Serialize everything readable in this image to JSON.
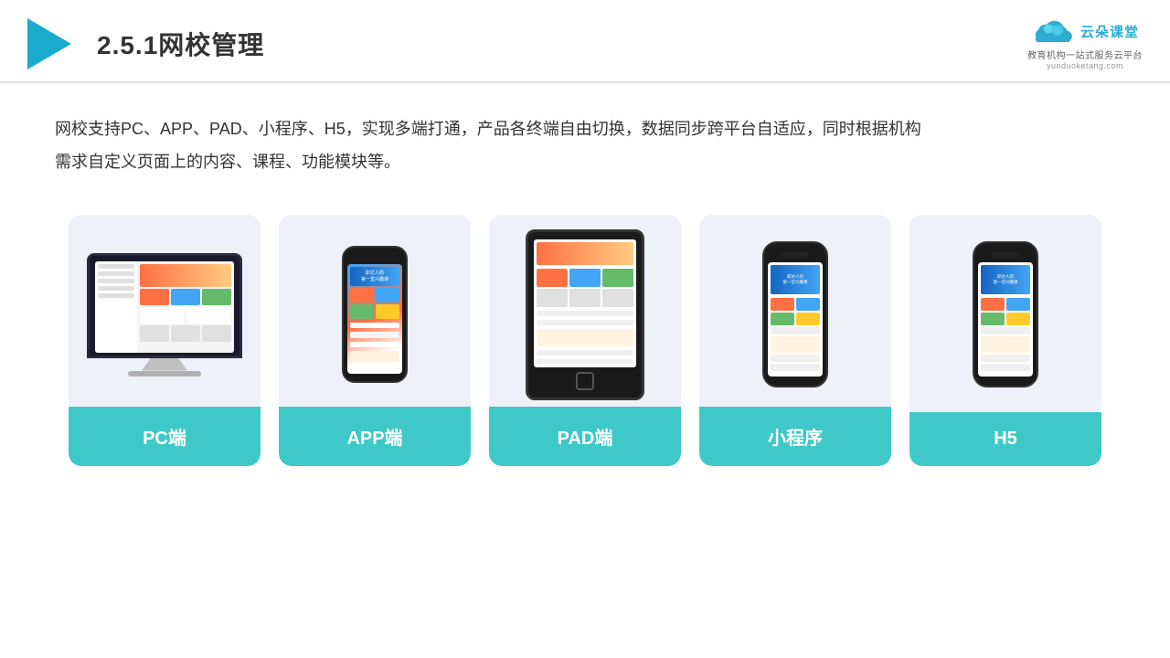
{
  "header": {
    "title": "2.5.1网校管理",
    "brand": {
      "name": "云朵课堂",
      "sub": "教育机构一站\n式服务云平台",
      "url": "yunduoketang.com"
    }
  },
  "description": {
    "line1": "网校支持PC、APP、PAD、小程序、H5，实现多端打通，产品各终端自由切换，数据同步跨平台自适应，同时根据机构",
    "line2": "需求自定义页面上的内容、课程、功能模块等。"
  },
  "cards": [
    {
      "id": "pc",
      "label": "PC端"
    },
    {
      "id": "app",
      "label": "APP端"
    },
    {
      "id": "pad",
      "label": "PAD端"
    },
    {
      "id": "miniapp",
      "label": "小程序"
    },
    {
      "id": "h5",
      "label": "H5"
    }
  ]
}
